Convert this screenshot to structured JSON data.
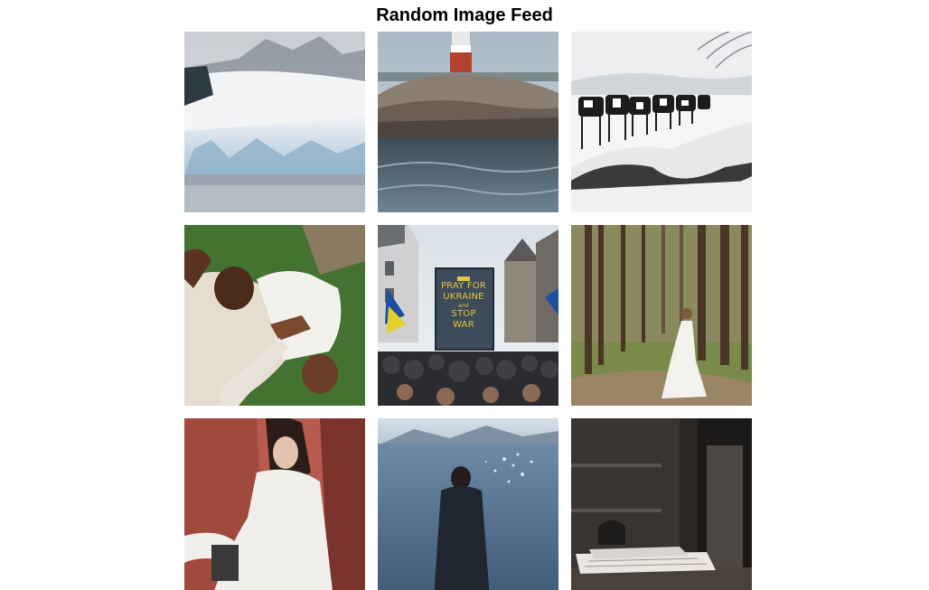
{
  "page": {
    "title": "Random Image Feed"
  },
  "feed": {
    "images": [
      {
        "subject": "glacier-coast"
      },
      {
        "subject": "lighthouse-island"
      },
      {
        "subject": "cows-in-snow"
      },
      {
        "subject": "couple-lying-on-grass"
      },
      {
        "subject": "protest-crowd",
        "sign": {
          "line1": "PRAY FOR",
          "line2": "UKRAINE",
          "line3": "and",
          "line4": "STOP",
          "line5": "WAR"
        }
      },
      {
        "subject": "woman-in-forest"
      },
      {
        "subject": "woman-in-white-shirt"
      },
      {
        "subject": "person-facing-lake"
      },
      {
        "subject": "dark-shop-interior"
      }
    ]
  },
  "colors": {
    "background": "#ffffff",
    "title": "#000000",
    "sign_text": "#e6c63a"
  }
}
